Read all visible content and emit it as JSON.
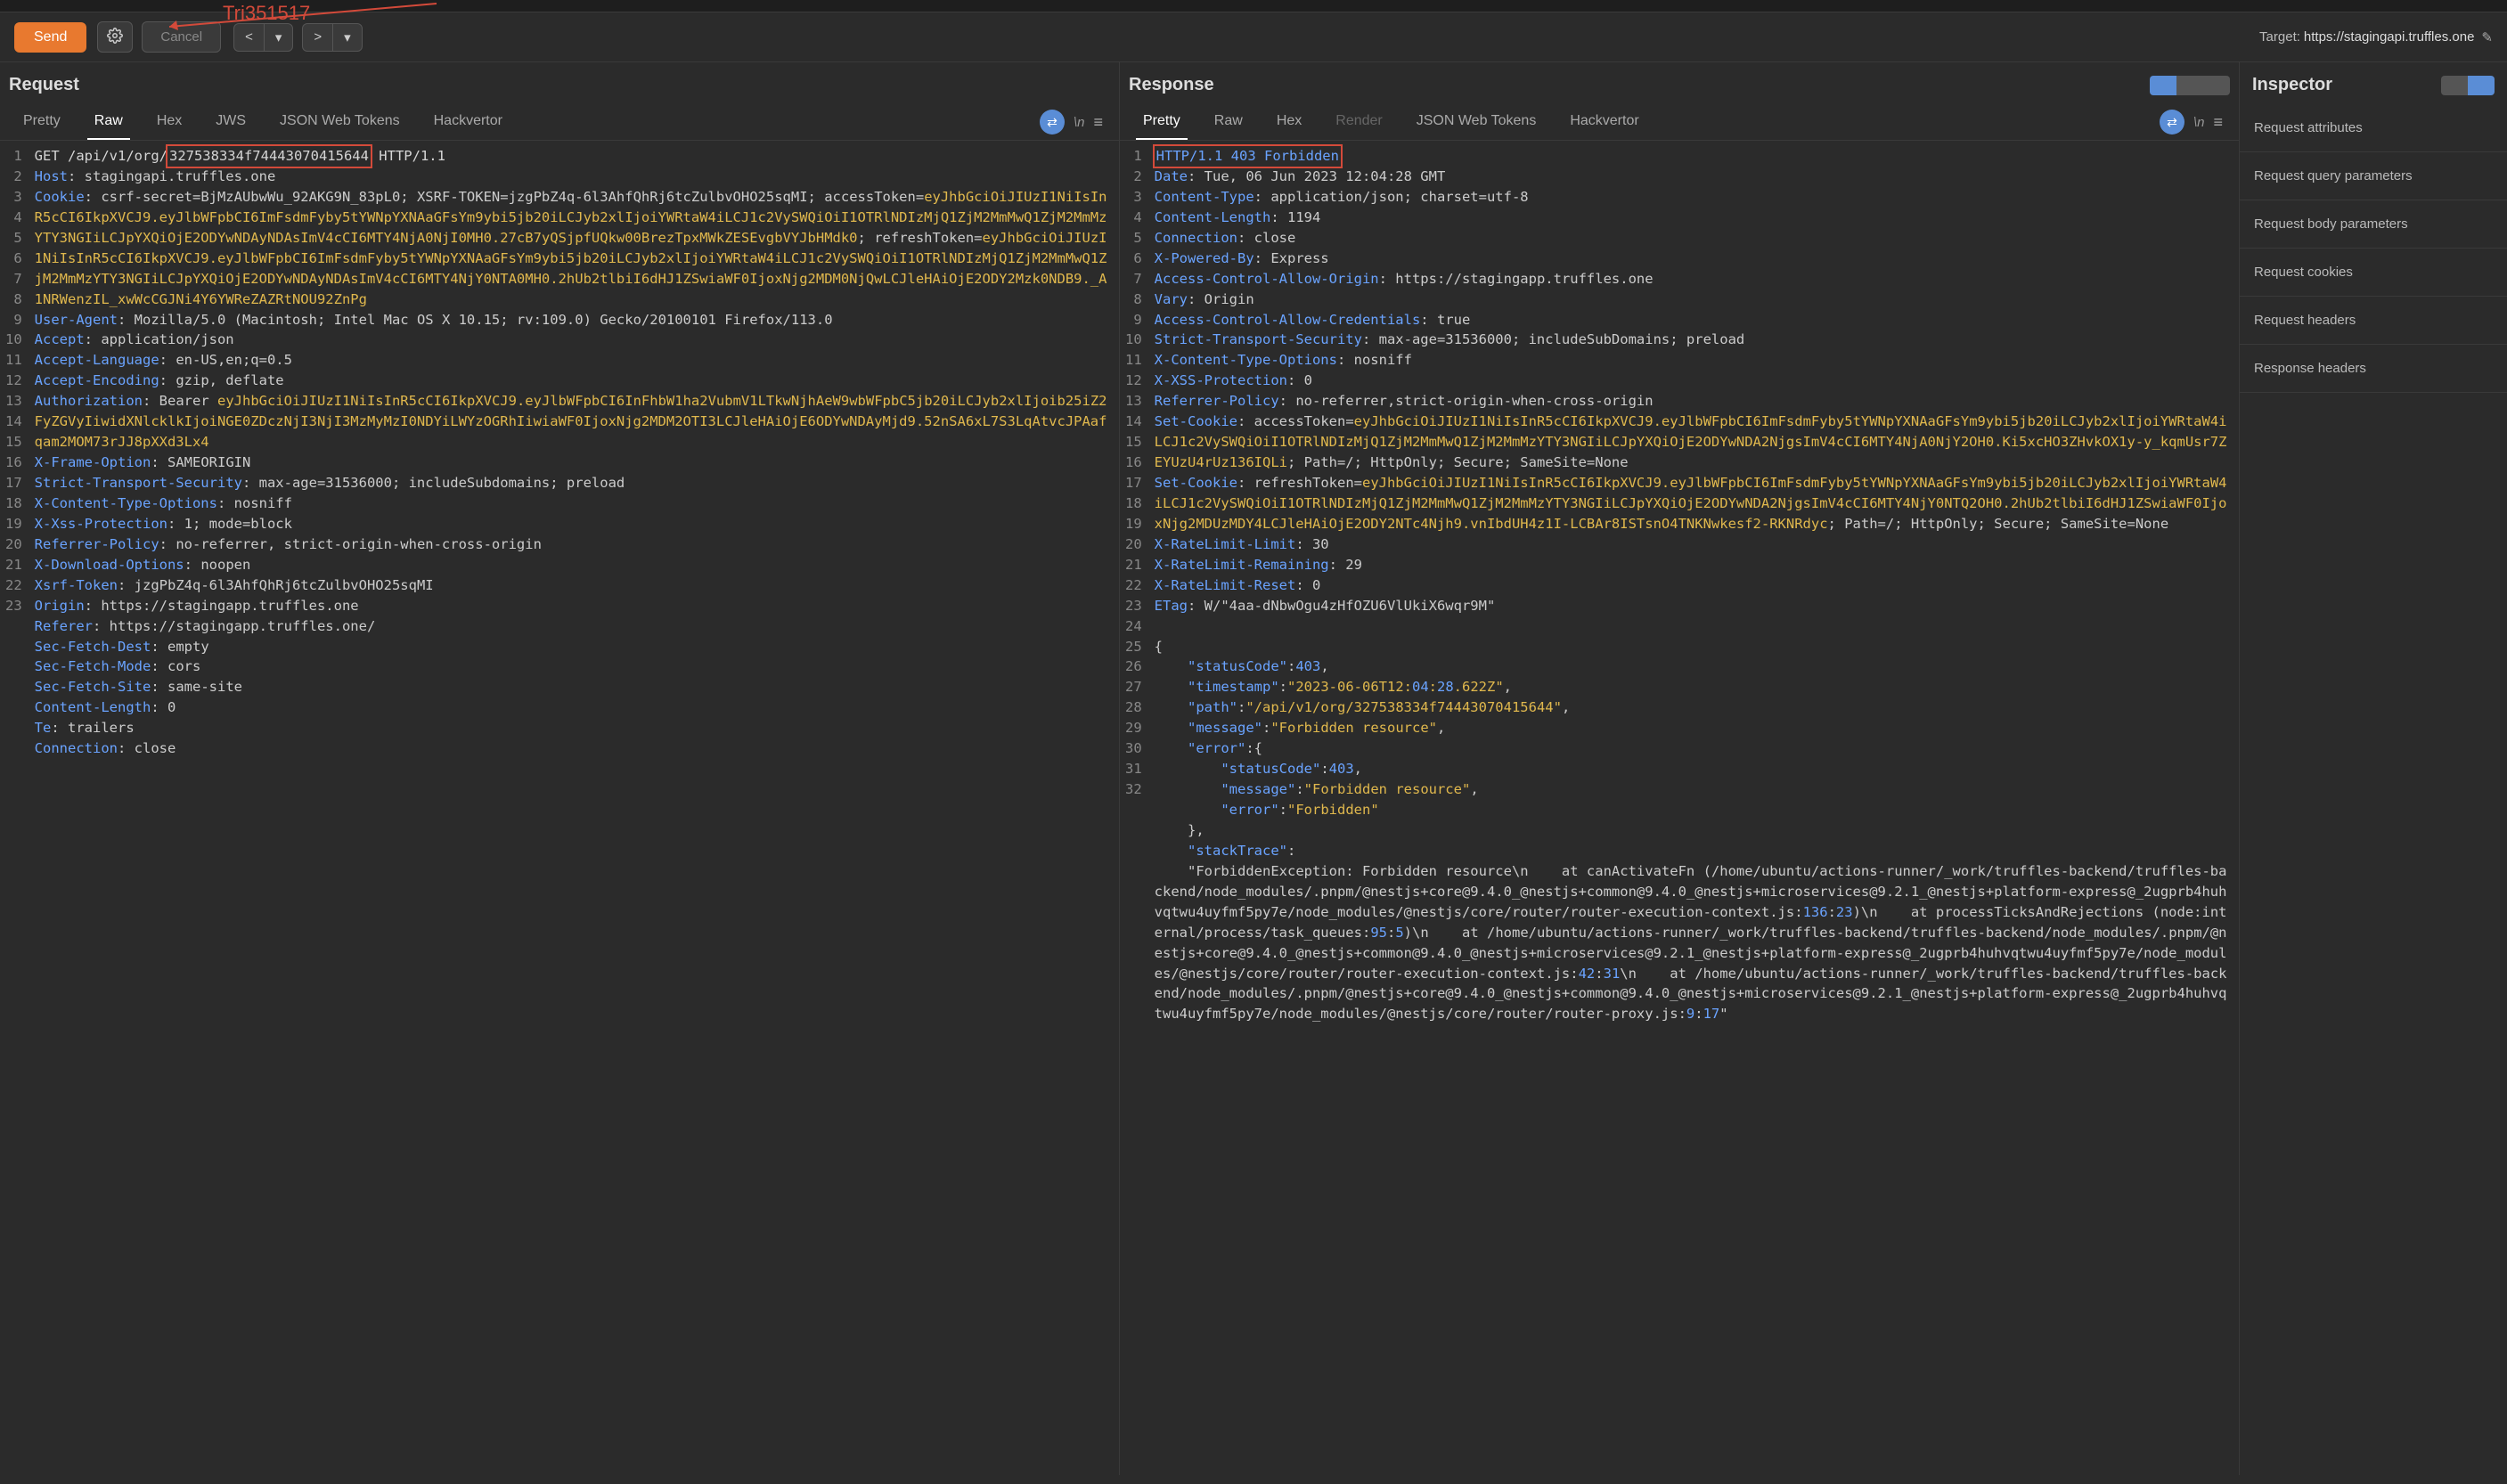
{
  "toolbar": {
    "send": "Send",
    "cancel": "Cancel",
    "target_label": "Target:",
    "target_value": "https://stagingapi.truffles.one"
  },
  "annotation": {
    "label": "Tri351517",
    "highlight_id": "327538334f74443070415644"
  },
  "request": {
    "title": "Request",
    "tabs": [
      "Pretty",
      "Raw",
      "Hex",
      "JWS",
      "JSON Web Tokens",
      "Hackvertor"
    ],
    "active_tab": "Raw",
    "lines": [
      "GET /api/v1/org/327538334f74443070415644 HTTP/1.1",
      "Host: stagingapi.truffles.one",
      "Cookie: csrf-secret=BjMzAUbwWu_92AKG9N_83pL0; XSRF-TOKEN=jzgPbZ4q-6l3AhfQhRj6tcZulbvOHO25sqMI; accessToken=eyJhbGciOiJIUzI1NiIsInR5cCI6IkpXVCJ9.eyJlbWFpbCI6ImFsdmFyby5tYWNpYXNAaGFsYm9ybi5jb20iLCJyb2xlIjoiYWRtaW4iLCJ1c2VySWQiOiI1OTRlNDIzMjQ1ZjM2MmMwQ1ZjM2MmMzYTY3NGIiLCJpYXQiOjE2ODYwNDAyNDAsImV4cCI6MTY4NjA0NjI0MH0.27cB7yQSjpfUQkw00BrezTpxMWkZESEvgbVYJbHMdk0; refreshToken=eyJhbGciOiJIUzI1NiIsInR5cCI6IkpXVCJ9.eyJlbWFpbCI6ImFsdmFyby5tYWNpYXNAaGFsYm9ybi5jb20iLCJyb2xlIjoiYWRtaW4iLCJ1c2VySWQiOiI1OTRlNDIzMjQ1ZjM2MmMwQ1ZjM2MmMzYTY3NGIiLCJpYXQiOjE2ODYwNDAyNDAsImV4cCI6MTY4NjY0NTA0MH0.2hUb2tlbiI6dHJ1ZSwiaWF0IjoxNjg2MDM0NjQwLCJleHAiOjE2ODY2Mzk0NDB9._A1NRWenzIL_xwWcCGJNi4Y6YWReZAZRtNOU92ZnPg",
      "User-Agent: Mozilla/5.0 (Macintosh; Intel Mac OS X 10.15; rv:109.0) Gecko/20100101 Firefox/113.0",
      "Accept: application/json",
      "Accept-Language: en-US,en;q=0.5",
      "Accept-Encoding: gzip, deflate",
      "Authorization: Bearer eyJhbGciOiJIUzI1NiIsInR5cCI6IkpXVCJ9.eyJlbWFpbCI6InFhbW1ha2VubmV1LTkwNjhAeW9wbWFpbC5jb20iLCJyb2xlIjoib25iZ2FyZGVyIiwidXNlcklkIjoiNGE0ZDczNjI3NjI3MzMyMzI0NDYiLWYzOGRhIiwiaWF0IjoxNjg2MDM2OTI3LCJleHAiOjE6ODYwNDAyMjd9.52nSA6xL7S3LqAtvcJPAafqam2MOM73rJJ8pXXd3Lx4",
      "X-Frame-Option: SAMEORIGIN",
      "Strict-Transport-Security: max-age=31536000; includeSubdomains; preload",
      "X-Content-Type-Options: nosniff",
      "X-Xss-Protection: 1; mode=block",
      "Referrer-Policy: no-referrer, strict-origin-when-cross-origin",
      "X-Download-Options: noopen",
      "Xsrf-Token: jzgPbZ4q-6l3AhfQhRj6tcZulbvOHO25sqMI",
      "Origin: https://stagingapp.truffles.one",
      "Referer: https://stagingapp.truffles.one/",
      "Sec-Fetch-Dest: empty",
      "Sec-Fetch-Mode: cors",
      "Sec-Fetch-Site: same-site",
      "Content-Length: 0",
      "Te: trailers",
      "Connection: close"
    ]
  },
  "response": {
    "title": "Response",
    "tabs": [
      "Pretty",
      "Raw",
      "Hex",
      "Render",
      "JSON Web Tokens",
      "Hackvertor"
    ],
    "active_tab": "Pretty",
    "lines": [
      "HTTP/1.1 403 Forbidden",
      "Date: Tue, 06 Jun 2023 12:04:28 GMT",
      "Content-Type: application/json; charset=utf-8",
      "Content-Length: 1194",
      "Connection: close",
      "X-Powered-By: Express",
      "Access-Control-Allow-Origin: https://stagingapp.truffles.one",
      "Vary: Origin",
      "Access-Control-Allow-Credentials: true",
      "Strict-Transport-Security: max-age=31536000; includeSubDomains; preload",
      "X-Content-Type-Options: nosniff",
      "X-XSS-Protection: 0",
      "Referrer-Policy: no-referrer,strict-origin-when-cross-origin",
      "Set-Cookie: accessToken=eyJhbGciOiJIUzI1NiIsInR5cCI6IkpXVCJ9.eyJlbWFpbCI6ImFsdmFyby5tYWNpYXNAaGFsYm9ybi5jb20iLCJyb2xlIjoiYWRtaW4iLCJ1c2VySWQiOiI1OTRlNDIzMjQ1ZjM2MmMwQ1ZjM2MmMzYTY3NGIiLCJpYXQiOjE2ODYwNDA2NjgsImV4cCI6MTY4NjA0NjY2OH0.Ki5xcHO3ZHvkOX1y-y_kqmUsr7ZEYUzU4rUz136IQLi; Path=/; HttpOnly; Secure; SameSite=None",
      "Set-Cookie: refreshToken=eyJhbGciOiJIUzI1NiIsInR5cCI6IkpXVCJ9.eyJlbWFpbCI6ImFsdmFyby5tYWNpYXNAaGFsYm9ybi5jb20iLCJyb2xlIjoiYWRtaW4iLCJ1c2VySWQiOiI1OTRlNDIzMjQ1ZjM2MmMwQ1ZjM2MmMzYTY3NGIiLCJpYXQiOjE2ODYwNDA2NjgsImV4cCI6MTY4NjY0NTQ2OH0.2hUb2tlbiI6dHJ1ZSwiaWF0IjoxNjg2MDUzMDY4LCJleHAiOjE2ODY2NTc4Njh9.vnIbdUH4z1I-LCBAr8ISTsnO4TNKNwkesf2-RKNRdyc; Path=/; HttpOnly; Secure; SameSite=None",
      "X-RateLimit-Limit: 30",
      "X-RateLimit-Remaining: 29",
      "X-RateLimit-Reset: 0",
      "ETag: W/\"4aa-dNbwOgu4zHfOZU6VlUkiX6wqr9M\"",
      "",
      "{",
      "    \"statusCode\":403,",
      "    \"timestamp\":\"2023-06-06T12:04:28.622Z\",",
      "    \"path\":\"/api/v1/org/327538334f74443070415644\",",
      "    \"message\":\"Forbidden resource\",",
      "    \"error\":{",
      "        \"statusCode\":403,",
      "        \"message\":\"Forbidden resource\",",
      "        \"error\":\"Forbidden\"",
      "    },",
      "    \"stackTrace\":",
      "    \"ForbiddenException: Forbidden resource\\n    at canActivateFn (/home/ubuntu/actions-runner/_work/truffles-backend/truffles-backend/node_modules/.pnpm/@nestjs+core@9.4.0_@nestjs+common@9.4.0_@nestjs+microservices@9.2.1_@nestjs+platform-express@_2ugprb4huhvqtwu4uyfmf5py7e/node_modules/@nestjs/core/router/router-execution-context.js:136:23)\\n    at processTicksAndRejections (node:internal/process/task_queues:95:5)\\n    at /home/ubuntu/actions-runner/_work/truffles-backend/truffles-backend/node_modules/.pnpm/@nestjs+core@9.4.0_@nestjs+common@9.4.0_@nestjs+microservices@9.2.1_@nestjs+platform-express@_2ugprb4huhvqtwu4uyfmf5py7e/node_modules/@nestjs/core/router/router-execution-context.js:42:31\\n    at /home/ubuntu/actions-runner/_work/truffles-backend/truffles-backend/node_modules/.pnpm/@nestjs+core@9.4.0_@nestjs+common@9.4.0_@nestjs+microservices@9.2.1_@nestjs+platform-express@_2ugprb4huhvqtwu4uyfmf5py7e/node_modules/@nestjs/core/router/router-proxy.js:9:17\""
    ]
  },
  "inspector": {
    "title": "Inspector",
    "items": [
      "Request attributes",
      "Request query parameters",
      "Request body parameters",
      "Request cookies",
      "Request headers",
      "Response headers"
    ]
  }
}
